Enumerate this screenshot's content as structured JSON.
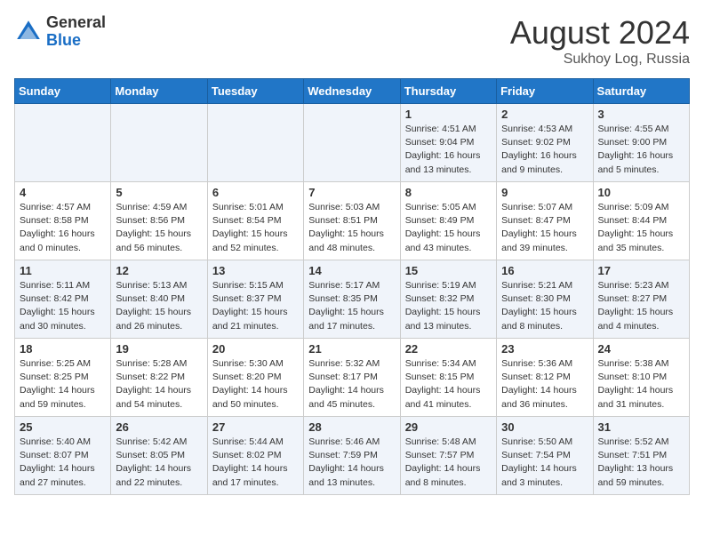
{
  "header": {
    "logo_line1": "General",
    "logo_line2": "Blue",
    "month_year": "August 2024",
    "location": "Sukhoy Log, Russia"
  },
  "weekdays": [
    "Sunday",
    "Monday",
    "Tuesday",
    "Wednesday",
    "Thursday",
    "Friday",
    "Saturday"
  ],
  "weeks": [
    [
      {
        "day": "",
        "content": ""
      },
      {
        "day": "",
        "content": ""
      },
      {
        "day": "",
        "content": ""
      },
      {
        "day": "",
        "content": ""
      },
      {
        "day": "1",
        "content": "Sunrise: 4:51 AM\nSunset: 9:04 PM\nDaylight: 16 hours\nand 13 minutes."
      },
      {
        "day": "2",
        "content": "Sunrise: 4:53 AM\nSunset: 9:02 PM\nDaylight: 16 hours\nand 9 minutes."
      },
      {
        "day": "3",
        "content": "Sunrise: 4:55 AM\nSunset: 9:00 PM\nDaylight: 16 hours\nand 5 minutes."
      }
    ],
    [
      {
        "day": "4",
        "content": "Sunrise: 4:57 AM\nSunset: 8:58 PM\nDaylight: 16 hours\nand 0 minutes."
      },
      {
        "day": "5",
        "content": "Sunrise: 4:59 AM\nSunset: 8:56 PM\nDaylight: 15 hours\nand 56 minutes."
      },
      {
        "day": "6",
        "content": "Sunrise: 5:01 AM\nSunset: 8:54 PM\nDaylight: 15 hours\nand 52 minutes."
      },
      {
        "day": "7",
        "content": "Sunrise: 5:03 AM\nSunset: 8:51 PM\nDaylight: 15 hours\nand 48 minutes."
      },
      {
        "day": "8",
        "content": "Sunrise: 5:05 AM\nSunset: 8:49 PM\nDaylight: 15 hours\nand 43 minutes."
      },
      {
        "day": "9",
        "content": "Sunrise: 5:07 AM\nSunset: 8:47 PM\nDaylight: 15 hours\nand 39 minutes."
      },
      {
        "day": "10",
        "content": "Sunrise: 5:09 AM\nSunset: 8:44 PM\nDaylight: 15 hours\nand 35 minutes."
      }
    ],
    [
      {
        "day": "11",
        "content": "Sunrise: 5:11 AM\nSunset: 8:42 PM\nDaylight: 15 hours\nand 30 minutes."
      },
      {
        "day": "12",
        "content": "Sunrise: 5:13 AM\nSunset: 8:40 PM\nDaylight: 15 hours\nand 26 minutes."
      },
      {
        "day": "13",
        "content": "Sunrise: 5:15 AM\nSunset: 8:37 PM\nDaylight: 15 hours\nand 21 minutes."
      },
      {
        "day": "14",
        "content": "Sunrise: 5:17 AM\nSunset: 8:35 PM\nDaylight: 15 hours\nand 17 minutes."
      },
      {
        "day": "15",
        "content": "Sunrise: 5:19 AM\nSunset: 8:32 PM\nDaylight: 15 hours\nand 13 minutes."
      },
      {
        "day": "16",
        "content": "Sunrise: 5:21 AM\nSunset: 8:30 PM\nDaylight: 15 hours\nand 8 minutes."
      },
      {
        "day": "17",
        "content": "Sunrise: 5:23 AM\nSunset: 8:27 PM\nDaylight: 15 hours\nand 4 minutes."
      }
    ],
    [
      {
        "day": "18",
        "content": "Sunrise: 5:25 AM\nSunset: 8:25 PM\nDaylight: 14 hours\nand 59 minutes."
      },
      {
        "day": "19",
        "content": "Sunrise: 5:28 AM\nSunset: 8:22 PM\nDaylight: 14 hours\nand 54 minutes."
      },
      {
        "day": "20",
        "content": "Sunrise: 5:30 AM\nSunset: 8:20 PM\nDaylight: 14 hours\nand 50 minutes."
      },
      {
        "day": "21",
        "content": "Sunrise: 5:32 AM\nSunset: 8:17 PM\nDaylight: 14 hours\nand 45 minutes."
      },
      {
        "day": "22",
        "content": "Sunrise: 5:34 AM\nSunset: 8:15 PM\nDaylight: 14 hours\nand 41 minutes."
      },
      {
        "day": "23",
        "content": "Sunrise: 5:36 AM\nSunset: 8:12 PM\nDaylight: 14 hours\nand 36 minutes."
      },
      {
        "day": "24",
        "content": "Sunrise: 5:38 AM\nSunset: 8:10 PM\nDaylight: 14 hours\nand 31 minutes."
      }
    ],
    [
      {
        "day": "25",
        "content": "Sunrise: 5:40 AM\nSunset: 8:07 PM\nDaylight: 14 hours\nand 27 minutes."
      },
      {
        "day": "26",
        "content": "Sunrise: 5:42 AM\nSunset: 8:05 PM\nDaylight: 14 hours\nand 22 minutes."
      },
      {
        "day": "27",
        "content": "Sunrise: 5:44 AM\nSunset: 8:02 PM\nDaylight: 14 hours\nand 17 minutes."
      },
      {
        "day": "28",
        "content": "Sunrise: 5:46 AM\nSunset: 7:59 PM\nDaylight: 14 hours\nand 13 minutes."
      },
      {
        "day": "29",
        "content": "Sunrise: 5:48 AM\nSunset: 7:57 PM\nDaylight: 14 hours\nand 8 minutes."
      },
      {
        "day": "30",
        "content": "Sunrise: 5:50 AM\nSunset: 7:54 PM\nDaylight: 14 hours\nand 3 minutes."
      },
      {
        "day": "31",
        "content": "Sunrise: 5:52 AM\nSunset: 7:51 PM\nDaylight: 13 hours\nand 59 minutes."
      }
    ]
  ]
}
